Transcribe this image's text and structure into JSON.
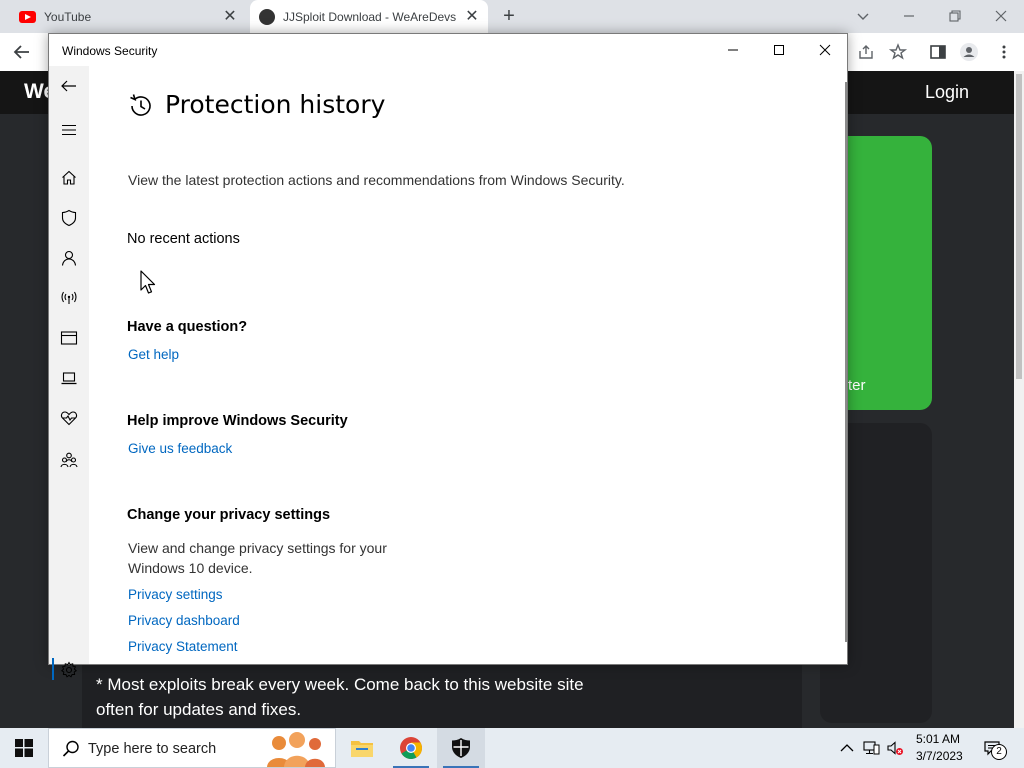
{
  "browser": {
    "tabs": [
      {
        "title": "YouTube"
      },
      {
        "title": "JJSploit Download - WeAreDevs"
      }
    ],
    "close_glyph": "✕",
    "new_tab_glyph": "+"
  },
  "website": {
    "logo_partial": "We",
    "login": "Login",
    "download_partial": "ter",
    "footer_note": "* Most exploits break every week. Come back to this website site often for updates and fixes.",
    "accent_color": "#35b23c"
  },
  "windows_security": {
    "window_title": "Windows Security",
    "page_title": "Protection history",
    "description": "View the latest protection actions and recommendations from Windows Security.",
    "empty_state": "No recent actions",
    "question": {
      "heading": "Have a question?",
      "link": "Get help"
    },
    "improve": {
      "heading": "Help improve Windows Security",
      "link": "Give us feedback"
    },
    "privacy": {
      "heading": "Change your privacy settings",
      "description": "View and change privacy settings for your Windows 10 device.",
      "links": [
        "Privacy settings",
        "Privacy dashboard",
        "Privacy Statement"
      ]
    },
    "nav_items": [
      "back-icon",
      "hamburger-menu-icon",
      "home-icon",
      "virus-protection-shield-icon",
      "account-protection-icon",
      "firewall-network-icon",
      "app-browser-control-icon",
      "device-security-icon",
      "device-health-icon",
      "family-options-icon",
      "settings-gear-icon"
    ],
    "link_color": "#0067c0"
  },
  "taskbar": {
    "search_placeholder": "Type here to search",
    "time": "5:01 AM",
    "date": "3/7/2023",
    "notification_count": "2"
  }
}
